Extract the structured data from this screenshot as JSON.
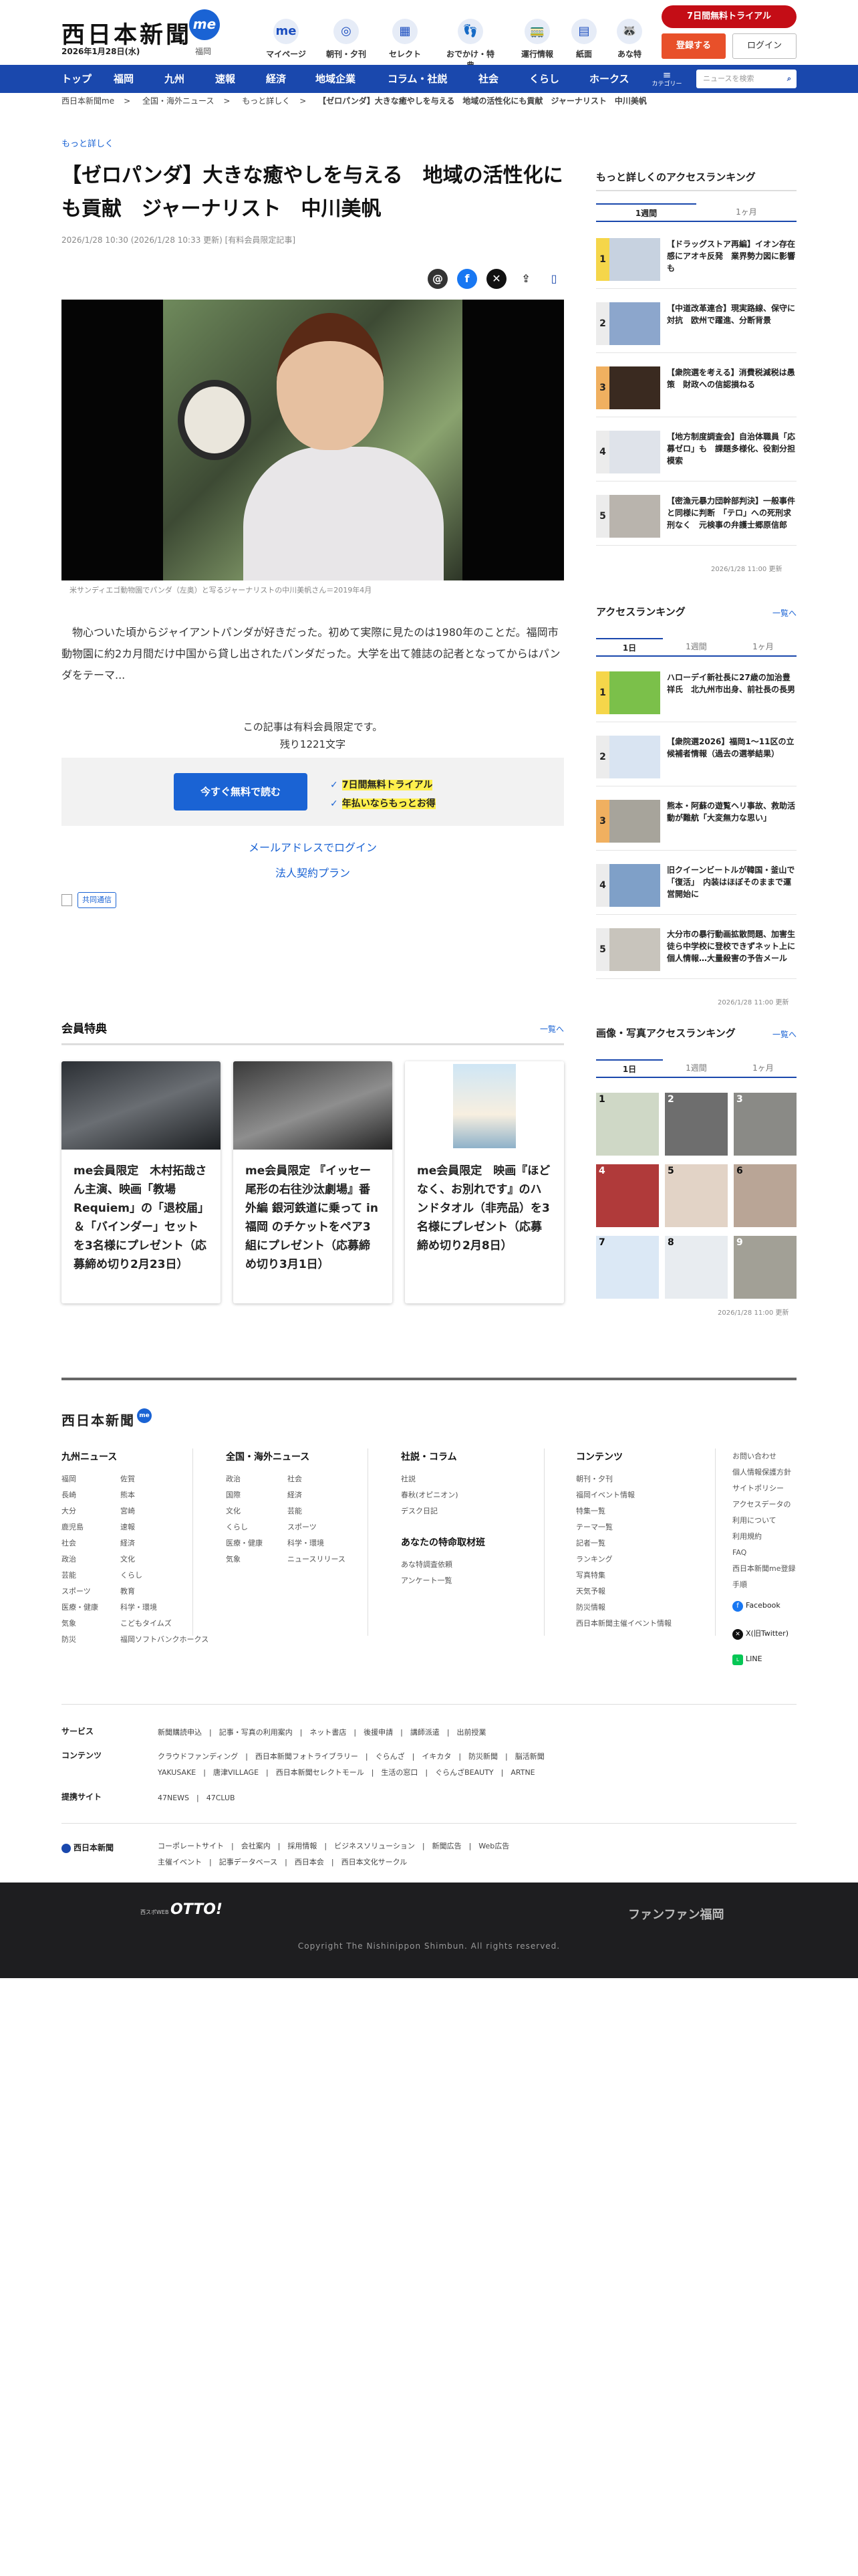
{
  "header": {
    "logo": "西日本新聞",
    "logo_badge": "me",
    "date": "2026年1月28日(水)",
    "region": "福岡",
    "nav": [
      {
        "icon": "me",
        "label": "マイページ"
      },
      {
        "icon": "◎",
        "label": "朝刊・夕刊"
      },
      {
        "icon": "▦",
        "label": "セレクト"
      },
      {
        "icon": "👣",
        "label": "おでかけ・特典"
      },
      {
        "icon": "🚃",
        "label": "運行情報"
      },
      {
        "icon": "▤",
        "label": "紙面"
      },
      {
        "icon": "🦝",
        "label": "あな特"
      }
    ],
    "trial": "7日間無料トライアル",
    "register": "登録する",
    "login": "ログイン"
  },
  "gnav": {
    "items": [
      "トップ",
      "福岡",
      "九州",
      "速報",
      "経済",
      "地域企業",
      "コラム・社説",
      "社会",
      "くらし",
      "ホークス"
    ],
    "category": "カテゴリー",
    "search_placeholder": "ニュースを検索",
    "search_icon": "search-icon"
  },
  "breadcrumb": [
    "西日本新聞me",
    ">",
    "全国・海外ニュース",
    ">",
    "もっと詳しく",
    ">",
    "【ゼロパンダ】大きな癒やしを与える　地域の活性化にも貢献　ジャーナリスト　中川美帆"
  ],
  "article": {
    "kicker": "もっと詳しく",
    "title": "【ゼロパンダ】大きな癒やしを与える　地域の活性化にも貢献　ジャーナリスト　中川美帆",
    "meta": "2026/1/28 10:30 (2026/1/28 10:33 更新) [有料会員限定記事]",
    "expand": "拡大",
    "caption": "米サンディエゴ動物園でパンダ（左奥）と写るジャーナリストの中川美帆さん＝2019年4月",
    "lead": "物心ついた頃からジャイアントパンダが好きだった。初めて実際に見たのは1980年のことだ。福岡市動物園に約2カ月間だけ中国から貸し出されたパンダだった。大学を出て雑誌の記者となってからはパンダをテーマ...",
    "paywall_1": "この記事は有料会員限定です。",
    "paywall_2": "残り1221文字",
    "cta": "今すぐ無料で読む",
    "feature_1": "7日間無料トライアル",
    "feature_2": "年払いならもっとお得",
    "mail_login": "メールアドレスでログイン",
    "corporate": "法人契約プラン",
    "tag": "共同通信"
  },
  "member": {
    "heading": "会員特典",
    "more": "一覧へ",
    "cards": [
      "me会員限定　木村拓哉さん主演、映画「教場 Requiem」の「退校届」＆「バインダー」セットを3名様にプレゼント（応募締め切り2月23日）",
      "me会員限定 『イッセー尾形の右往沙汰劇場』番外編 銀河鉄道に乗って in福岡 のチケットをペア3組にプレゼント（応募締め切り3月1日）",
      "me会員限定　映画『ほどなく、お別れです』のハンドタオル（非売品）を3名様にプレゼント（応募締め切り2月8日）"
    ]
  },
  "side": {
    "detail_heading": "もっと詳しくのアクセスランキング",
    "detail_tabs": [
      "1週間",
      "1ヶ月"
    ],
    "detail": [
      {
        "n": "1",
        "t": "【ドラッグストア再編】イオン存在感にアオキ反発　業界勢力図に影響も"
      },
      {
        "n": "2",
        "t": "【中道改革連合】現実路線、保守に対抗　欧州で躍進、分断背景"
      },
      {
        "n": "3",
        "t": "【衆院選を考える】消費税減税は愚策　財政への信認損ねる"
      },
      {
        "n": "4",
        "t": "【地方制度調査会】自治体職員「応募ゼロ」も　課題多様化、役割分担模索"
      },
      {
        "n": "5",
        "t": "【密漁元暴力団幹部判決】一般事件と同様に判断　「テロ」への死刑求刑なく　元検事の弁護士郷原信郎"
      }
    ],
    "detail_updated": "2026/1/28 11:00 更新",
    "access_heading": "アクセスランキング",
    "access_more": "一覧へ",
    "access_tabs": [
      "1日",
      "1週間",
      "1ヶ月"
    ],
    "access": [
      {
        "n": "1",
        "t": "ハローデイ新社長に27歳の加治豊祥氏　北九州市出身、前社長の長男"
      },
      {
        "n": "2",
        "t": "【衆院選2026】福岡1～11区の立候補者情報（過去の選挙結果）"
      },
      {
        "n": "3",
        "t": "熊本・阿蘇の遊覧ヘリ事故、救助活動が難航「大変無力な思い」"
      },
      {
        "n": "4",
        "t": "旧クイーンビートルが韓国・釜山で「復活」　内装はほぼそのままで運営開始に"
      },
      {
        "n": "5",
        "t": "大分市の暴行動画拡散問題、加害生徒ら中学校に登校できずネット上に個人情報…大量殺害の予告メール"
      }
    ],
    "access_updated": "2026/1/28 11:00 更新",
    "photo_heading": "画像・写真アクセスランキング",
    "photo_more": "一覧へ",
    "photo_tabs": [
      "1日",
      "1週間",
      "1ヶ月"
    ],
    "photo_nums": [
      "1",
      "2",
      "3",
      "4",
      "5",
      "6",
      "7",
      "8",
      "9"
    ],
    "photo_updated": "2026/1/28 11:00 更新"
  },
  "footer": {
    "logo": "西日本新聞",
    "logo_badge": "me",
    "cols": [
      {
        "h": "九州ニュース",
        "a": [
          "福岡",
          "長崎",
          "大分",
          "鹿児島",
          "社会",
          "政治",
          "芸能",
          "スポーツ",
          "医療・健康",
          "気象",
          "防災"
        ],
        "b": [
          "佐賀",
          "熊本",
          "宮崎",
          "速報",
          "経済",
          "文化",
          "くらし",
          "教育",
          "科学・環境",
          "こどもタイムズ",
          "福岡ソフトバンクホークス"
        ]
      },
      {
        "h": "全国・海外ニュース",
        "a": [
          "政治",
          "国際",
          "文化",
          "くらし",
          "医療・健康",
          "気象"
        ],
        "b": [
          "社会",
          "経済",
          "芸能",
          "スポーツ",
          "科学・環境",
          "ニュースリリース"
        ]
      },
      {
        "h": "社説・コラム",
        "a": [
          "社説",
          "春秋(オピニオン)",
          "デスク日記"
        ]
      },
      {
        "h": "コンテンツ",
        "a": [
          "朝刊・夕刊",
          "福岡イベント情報",
          "特集一覧",
          "テーマ一覧",
          "記者一覧",
          "ランキング",
          "写真特集",
          "天気予報",
          "防災情報",
          "西日本新聞主催イベント情報"
        ]
      }
    ],
    "special_h": "あなたの特命取材班",
    "special": [
      "あな特調査依頼",
      "アンケート一覧"
    ],
    "right": [
      "お問い合わせ",
      "個人情報保護方針",
      "サイトポリシー",
      "アクセスデータの利用について",
      "利用規約",
      "FAQ",
      "西日本新聞me登録手順"
    ],
    "social": [
      "Facebook",
      "X(旧Twitter)",
      "LINE"
    ],
    "service_l": "サービス",
    "service": "新聞購読申込　|　記事・写真の利用案内　|　ネット書店　|　後援申請　|　講師派遣　|　出前授業",
    "content_l": "コンテンツ",
    "content_1": "クラウドファンディング　|　西日本新聞フォトライブラリー　|　ぐらんざ　|　イキカタ　|　防災新聞　|　脳活新聞",
    "content_2": "YAKUSAKE　|　唐津VILLAGE　|　西日本新聞セレクトモール　|　生活の窓口　|　ぐらんざBEAUTY　|　ARTNE",
    "partner_l": "提携サイト",
    "partner": "47NEWS　|　47CLUB",
    "corp_logo": "西日本新聞",
    "corp_1": "コーポレートサイト　|　会社案内　|　採用情報　|　ビジネスソリューション　|　新聞広告　|　Web広告",
    "corp_2": "主催イベント　|　記事データベース　|　西日本会　|　西日本文化サークル",
    "banner_1": "OTTO!",
    "banner_1_sub": "西スポWEB",
    "banner_2": "ファンファン福岡",
    "copyright": "Copyright The Nishinippon Shimbun. All rights reserved."
  }
}
